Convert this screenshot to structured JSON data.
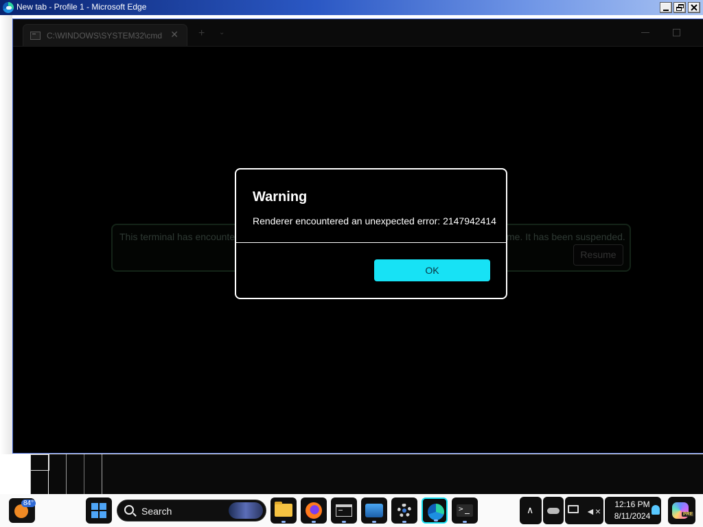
{
  "browser": {
    "title": "New tab - Profile 1 - Microsoft Edge"
  },
  "terminal": {
    "tab_title": "C:\\WINDOWS\\SYSTEM32\\cmd",
    "tab_close": "✕",
    "new_tab": "+",
    "dropdown": "⌄"
  },
  "infobar": {
    "text_left": "This terminal has encounte",
    "text_right": "me. It has been suspended.",
    "resume_label": "Resume"
  },
  "dialog": {
    "title": "Warning",
    "message": "Renderer encountered an unexpected error: 2147942414",
    "ok_label": "OK"
  },
  "taskbar": {
    "weather_temp": "84°",
    "search_label": "Search",
    "apps": [
      "file-explorer",
      "firefox",
      "command-prompt",
      "photos",
      "settings",
      "microsoft-edge",
      "windows-terminal"
    ],
    "clock_time": "12:16 PM",
    "clock_date": "8/11/2024",
    "copilot_badge": "PRE"
  },
  "colors": {
    "ok_button": "#17e2f5",
    "dialog_bg": "#000000",
    "title_bar_start": "#0a2470"
  }
}
